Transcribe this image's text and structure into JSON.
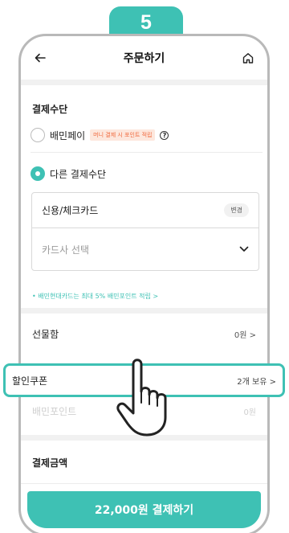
{
  "step": {
    "number": "5"
  },
  "header": {
    "title": "주문하기",
    "back_icon": "arrow-left-icon",
    "home_icon": "home-icon"
  },
  "payment": {
    "section_title": "결제수단",
    "baemin_pay": {
      "label": "배민페이",
      "promo": "머니 결제 시 포인트 적립",
      "help": "?"
    },
    "other": {
      "label": "다른 결제수단"
    },
    "card_type": {
      "value": "신용/체크카드",
      "change_label": "변경"
    },
    "card_company": {
      "placeholder": "카드사 선택"
    },
    "benefit_note": "• 배민현대카드는 최대 5% 배민포인트 적립 >"
  },
  "discounts": {
    "gift": {
      "label": "선물함",
      "value": "0원 >"
    },
    "coupon": {
      "label": "할인쿠폰",
      "value": "2개 보유 >"
    },
    "points": {
      "label": "배민포인트",
      "value": "0원"
    }
  },
  "amount": {
    "section_title": "결제금액"
  },
  "pay_button": {
    "label": "22,000원 결제하기"
  },
  "colors": {
    "accent": "#3ec1b4",
    "promo": "#f06a3e"
  }
}
